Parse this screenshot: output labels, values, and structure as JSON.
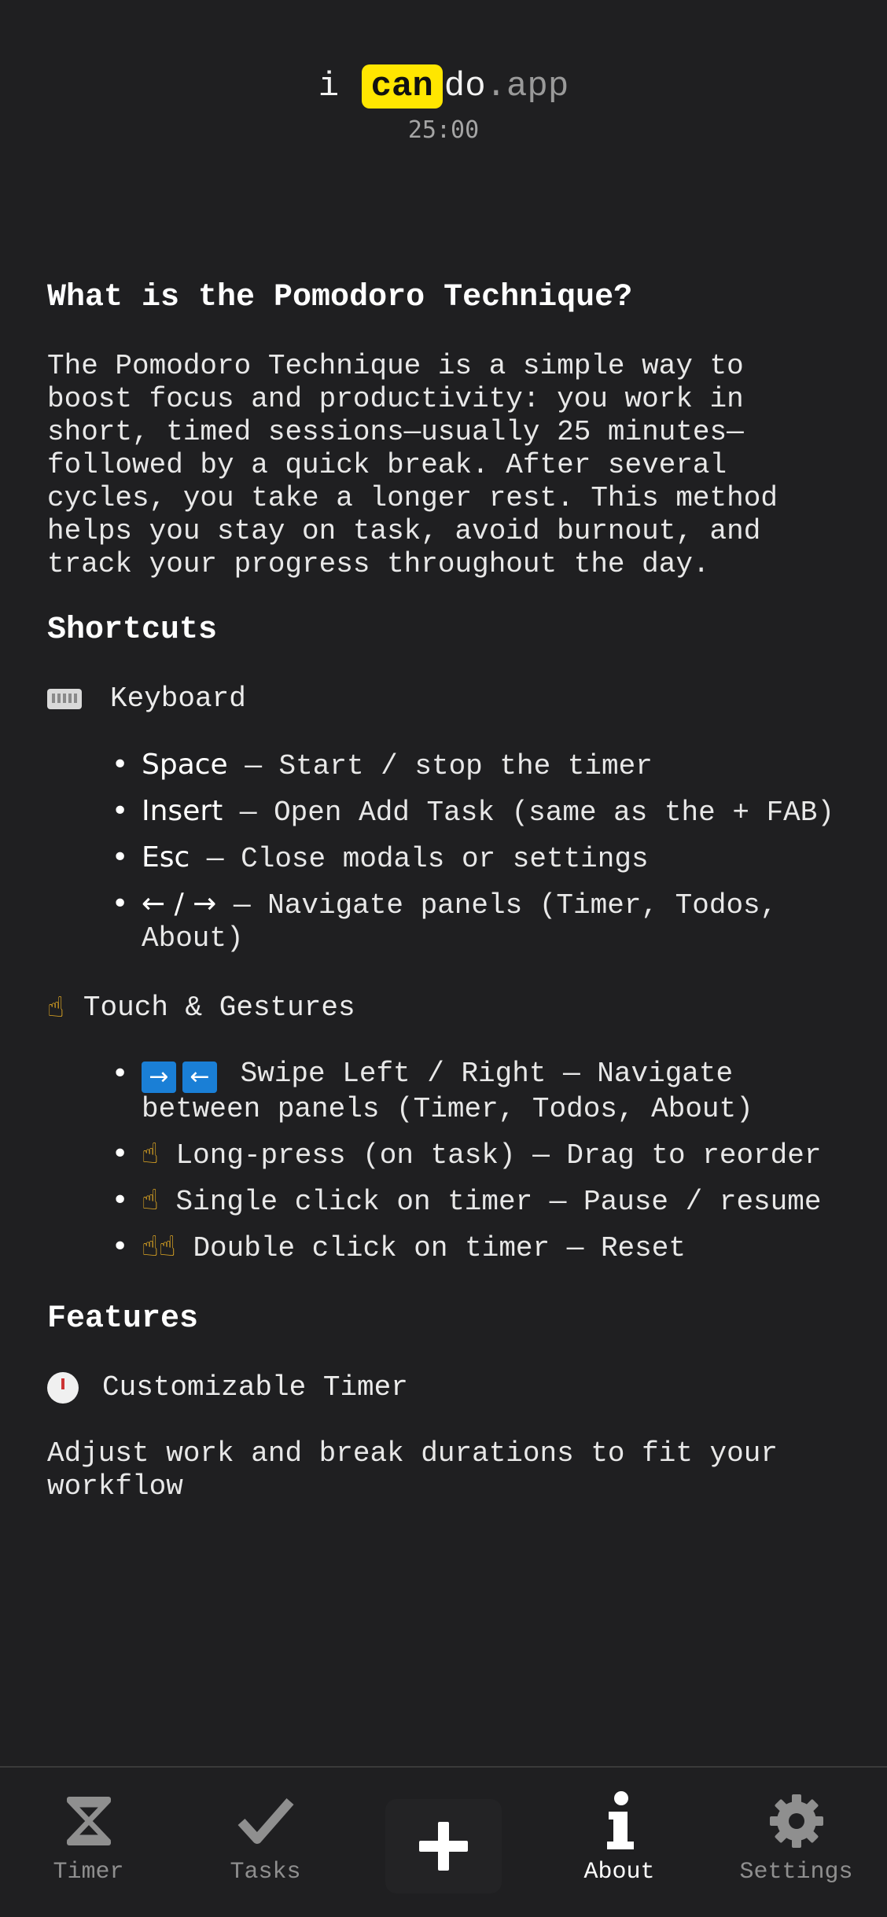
{
  "header": {
    "brand_prefix": "i",
    "brand_highlight": "can",
    "brand_do": "do",
    "brand_tld": ".app",
    "timer": "25:00"
  },
  "about": {
    "title": "What is the Pomodoro Technique?",
    "intro": "The Pomodoro Technique is a simple way to boost focus and productivity: you work in short, timed sessions—usually 25 minutes—followed by a quick break. After several cycles, you take a longer rest. This method helps you stay on task, avoid burnout, and track your progress throughout the day.",
    "shortcuts_title": "Shortcuts",
    "keyboard": {
      "label": "Keyboard",
      "items": [
        {
          "key": "Space",
          "text": " — Start / stop the timer"
        },
        {
          "key": "Insert",
          "text": " — Open Add Task (same as the + FAB)"
        },
        {
          "key": "Esc",
          "text": " — Close modals or settings"
        },
        {
          "key": "← / →",
          "text": " — Navigate panels (Timer, Todos, About)"
        }
      ]
    },
    "touch": {
      "label": "Touch & Gestures",
      "items": [
        {
          "icon": "➡ ⬅",
          "text": "Swipe Left / Right — Navigate between panels (Timer, Todos, About)"
        },
        {
          "icon": "👆",
          "text": "Long-press (on task) — Drag to reorder"
        },
        {
          "icon": "👆",
          "text": "Single click on timer — Pause / resume"
        },
        {
          "icon": "👆👆",
          "text": "Double click on timer — Reset"
        }
      ]
    },
    "features_title": "Features",
    "feature": {
      "label": "Customizable Timer",
      "desc": "Adjust work and break durations to fit your workflow"
    }
  },
  "tabbar": {
    "timer": "Timer",
    "tasks": "Tasks",
    "about": "About",
    "settings": "Settings",
    "active": "about"
  },
  "colors": {
    "background": "#1f1f21",
    "brand_highlight": "#ffe600",
    "swipe_icon": "#1a7fd6"
  }
}
